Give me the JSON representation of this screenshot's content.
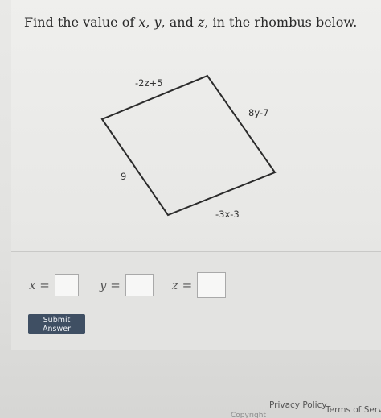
{
  "question": {
    "prefix": "Find the value of ",
    "var_x": "x",
    "sep1": ", ",
    "var_y": "y",
    "sep2": ", and ",
    "var_z": "z",
    "suffix": ", in the rhombus below."
  },
  "figure": {
    "label_top": "-2z+5",
    "label_right": "8y-7",
    "label_left": "9",
    "label_bottom": "-3x-3"
  },
  "answers": [
    {
      "label": "x =",
      "value": ""
    },
    {
      "label": "y =",
      "value": ""
    },
    {
      "label": "z =",
      "value": ""
    }
  ],
  "submit": {
    "label": "Submit Answer"
  },
  "footer": {
    "privacy": "Privacy Policy",
    "terms": "Terms of Servic",
    "copyright": "Copyright"
  },
  "colors": {
    "button_bg": "#3f4f63",
    "background": "#e6e6e4"
  }
}
